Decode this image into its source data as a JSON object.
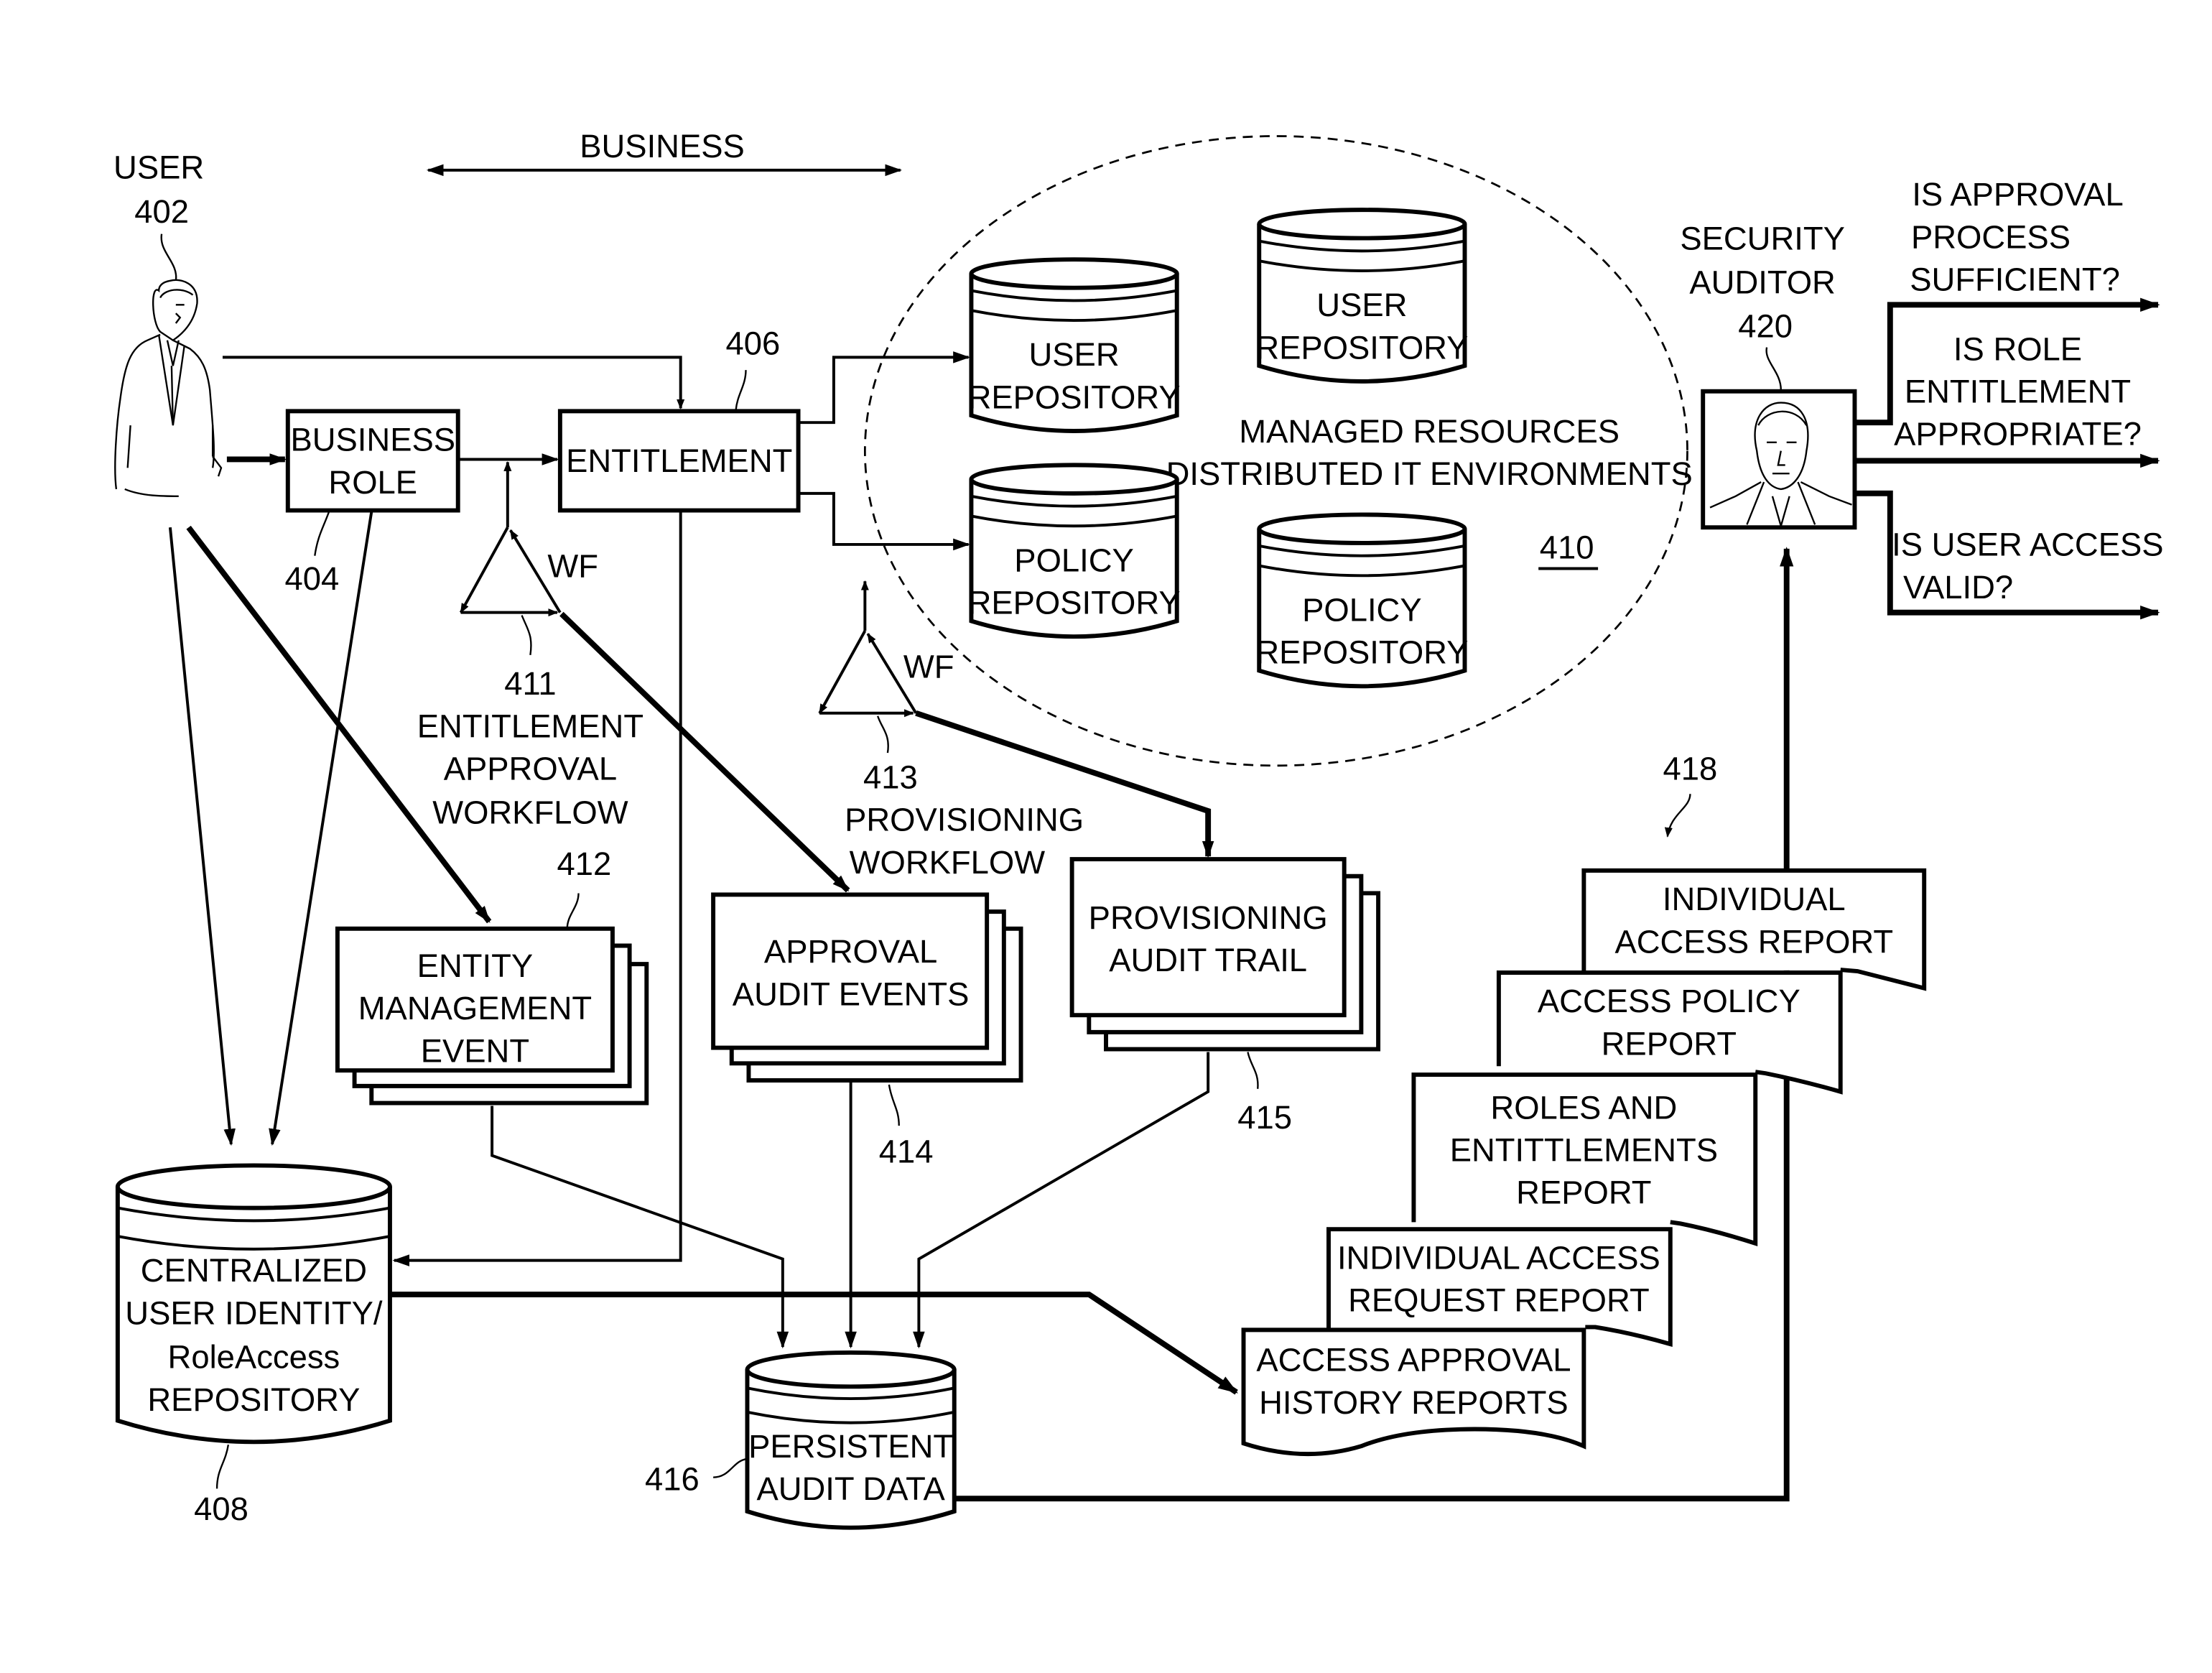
{
  "header": {
    "business_label": "BUSINESS"
  },
  "user": {
    "label": "USER",
    "ref": "402"
  },
  "business_role": {
    "lines": [
      "BUSINESS",
      "ROLE"
    ],
    "ref": "404"
  },
  "entitlement": {
    "label": "ENTITLEMENT",
    "ref": "406"
  },
  "managed_resources": {
    "lines": [
      "MANAGED RESOURCES",
      "DISTRIBUTED IT ENVIRONMENTS"
    ],
    "ref": "410",
    "repositories": [
      {
        "lines": [
          "USER",
          "REPOSITORY"
        ]
      },
      {
        "lines": [
          "POLICY",
          "REPOSITORY"
        ]
      },
      {
        "lines": [
          "USER",
          "REPOSITORY"
        ]
      },
      {
        "lines": [
          "POLICY",
          "REPOSITORY"
        ]
      }
    ]
  },
  "workflows": [
    {
      "tag": "WF",
      "ref": "411",
      "lines": [
        "ENTITLEMENT",
        "APPROVAL",
        "WORKFLOW"
      ]
    },
    {
      "tag": "WF",
      "ref": "413",
      "lines": [
        "PROVISIONING",
        "WORKFLOW"
      ]
    }
  ],
  "event_stacks": [
    {
      "ref": "412",
      "lines": [
        "ENTITY",
        "MANAGEMENT",
        "EVENT"
      ]
    },
    {
      "ref": "414",
      "lines": [
        "APPROVAL",
        "AUDIT EVENTS"
      ]
    },
    {
      "ref": "415",
      "lines": [
        "PROVISIONING",
        "AUDIT TRAIL"
      ]
    }
  ],
  "central_repository": {
    "lines": [
      "CENTRALIZED",
      "USER IDENTITY/",
      "RoleAccess",
      "REPOSITORY"
    ],
    "ref": "408"
  },
  "persistent_audit": {
    "lines": [
      "PERSISTENT",
      "AUDIT DATA"
    ],
    "ref": "416"
  },
  "reports": {
    "ref": "418",
    "items": [
      {
        "lines": [
          "INDIVIDUAL",
          "ACCESS REPORT"
        ]
      },
      {
        "lines": [
          "ACCESS POLICY",
          "REPORT"
        ]
      },
      {
        "lines": [
          "ROLES AND",
          "ENTITTLEMENTS",
          "REPORT"
        ]
      },
      {
        "lines": [
          "INDIVIDUAL ACCESS",
          "REQUEST REPORT"
        ]
      },
      {
        "lines": [
          "ACCESS APPROVAL",
          "HISTORY REPORTS"
        ]
      }
    ]
  },
  "auditor": {
    "lines": [
      "SECURITY",
      "AUDITOR"
    ],
    "ref": "420"
  },
  "questions": [
    {
      "lines": [
        "IS APPROVAL",
        "PROCESS",
        "SUFFICIENT?"
      ]
    },
    {
      "lines": [
        "IS ROLE",
        "ENTITLEMENT",
        "APPROPRIATE?"
      ]
    },
    {
      "lines": [
        "IS USER ACCESS",
        "VALID?"
      ]
    }
  ]
}
